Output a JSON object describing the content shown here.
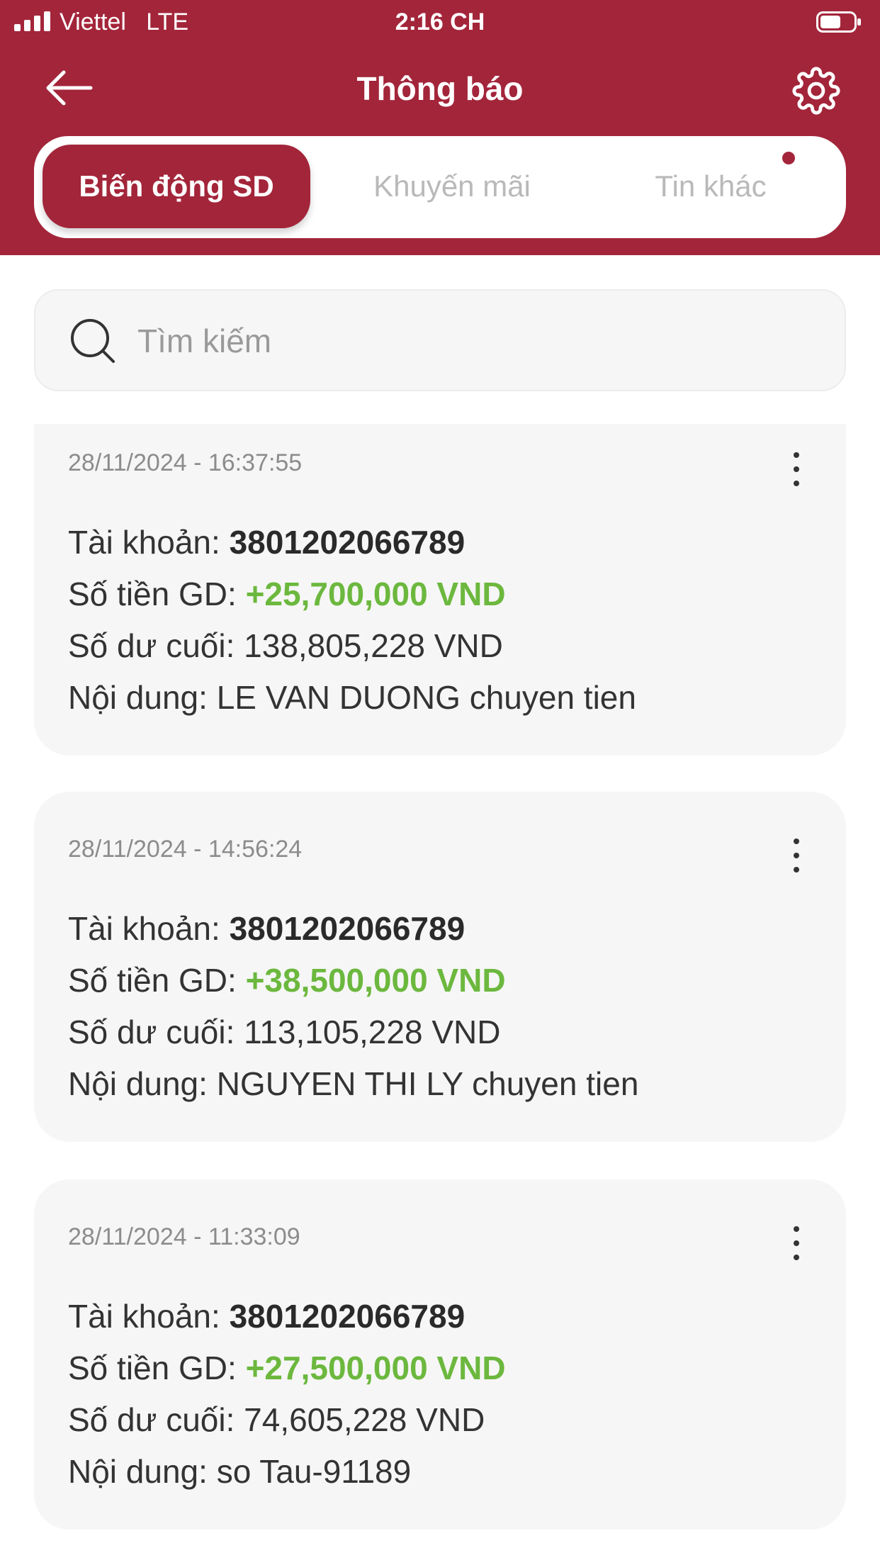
{
  "status_bar": {
    "carrier": "Viettel   LTE",
    "time": "2:16 CH"
  },
  "header": {
    "title": "Thông báo"
  },
  "tabs": [
    {
      "label": "Biến động SD",
      "active": true
    },
    {
      "label": "Khuyến mãi",
      "active": false
    },
    {
      "label": "Tin khác",
      "active": false
    }
  ],
  "search": {
    "placeholder": "Tìm kiếm"
  },
  "colors": {
    "brand": "#a3253a",
    "positive_amount": "#6cb83e"
  },
  "labels": {
    "account": "Tài khoản:",
    "amount": "Số tiền GD:",
    "balance": "Số dư cuối:",
    "content": "Nội dung:"
  },
  "notifications": [
    {
      "timestamp": "28/11/2024 - 16:37:55",
      "account": "3801202066789",
      "amount": "+25,700,000 VND",
      "balance": "138,805,228 VND",
      "content": "LE VAN DUONG chuyen tien"
    },
    {
      "timestamp": "28/11/2024 - 14:56:24",
      "account": "3801202066789",
      "amount": "+38,500,000 VND",
      "balance": "113,105,228 VND",
      "content": "NGUYEN THI LY chuyen tien"
    },
    {
      "timestamp": "28/11/2024 - 11:33:09",
      "account": "3801202066789",
      "amount": "+27,500,000 VND",
      "balance": "74,605,228 VND",
      "content": "so Tau-91189"
    }
  ]
}
